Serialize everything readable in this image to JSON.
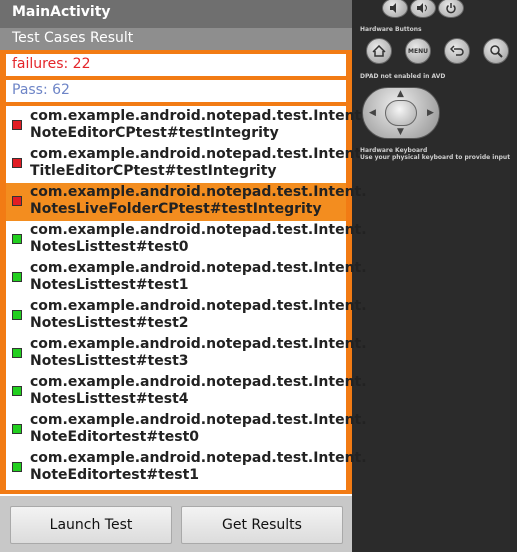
{
  "titlebar": {
    "title": "MainActivity"
  },
  "header": {
    "section_title": "Test Cases Result"
  },
  "summary": {
    "failures": "failures: 22",
    "pass": "Pass:  62"
  },
  "results": [
    {
      "line1": "com.example.android.notepad.test.Intent.",
      "line2": "NoteEditorCPtest#testIntegrity",
      "status": "fail",
      "selected": false
    },
    {
      "line1": "com.example.android.notepad.test.Intent.",
      "line2": "TitleEditorCPtest#testIntegrity",
      "status": "fail",
      "selected": false
    },
    {
      "line1": "com.example.android.notepad.test.Intent.",
      "line2": "NotesLiveFolderCPtest#testIntegrity",
      "status": "fail",
      "selected": true
    },
    {
      "line1": "com.example.android.notepad.test.Intent.",
      "line2": "NotesListtest#test0",
      "status": "pass",
      "selected": false
    },
    {
      "line1": "com.example.android.notepad.test.Intent.",
      "line2": "NotesListtest#test1",
      "status": "pass",
      "selected": false
    },
    {
      "line1": "com.example.android.notepad.test.Intent.",
      "line2": "NotesListtest#test2",
      "status": "pass",
      "selected": false
    },
    {
      "line1": "com.example.android.notepad.test.Intent.",
      "line2": "NotesListtest#test3",
      "status": "pass",
      "selected": false
    },
    {
      "line1": "com.example.android.notepad.test.Intent.",
      "line2": "NotesListtest#test4",
      "status": "pass",
      "selected": false
    },
    {
      "line1": "com.example.android.notepad.test.Intent.",
      "line2": "NoteEditortest#test0",
      "status": "pass",
      "selected": false
    },
    {
      "line1": "com.example.android.notepad.test.Intent.",
      "line2": "NoteEditortest#test1",
      "status": "pass",
      "selected": false
    }
  ],
  "footer": {
    "launch_label": "Launch Test",
    "results_label": "Get Results"
  },
  "emulator": {
    "hardware_buttons_label": "Hardware Buttons",
    "menu_label": "MENU",
    "dpad_label": "DPAD not enabled in AVD",
    "keyboard_title": "Hardware Keyboard",
    "keyboard_hint": "Use your physical keyboard to provide input"
  },
  "colors": {
    "accent": "#f27b14",
    "fail": "#e11d24",
    "pass": "#22cf1f",
    "selected": "#f38d1f"
  }
}
